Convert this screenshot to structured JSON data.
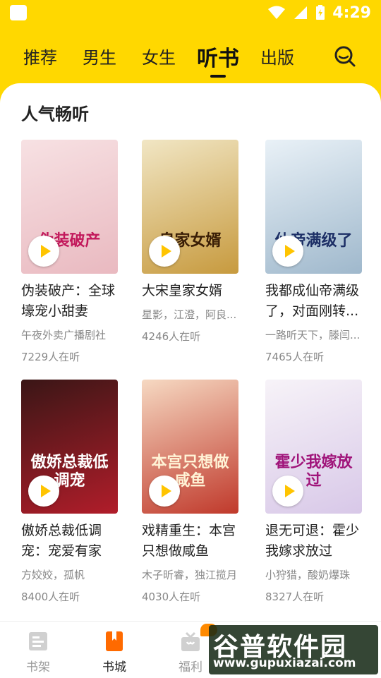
{
  "status_bar": {
    "time": "4:29"
  },
  "top_nav": {
    "tabs": [
      {
        "label": "推荐"
      },
      {
        "label": "男生"
      },
      {
        "label": "女生"
      },
      {
        "label": "听书"
      },
      {
        "label": "出版"
      }
    ],
    "active_tab": "听书",
    "search_icon": "search-icon"
  },
  "section": {
    "title": "人气畅听"
  },
  "books": [
    {
      "title": "伪装破产：全球壕宠小甜妻",
      "author": "午夜外卖广播剧社",
      "listeners": "7229人在听",
      "cover_text": "伪装破产",
      "cover_colors": [
        "#f7e1e3",
        "#e9b9c0"
      ],
      "cover_text_color": "#c2185b"
    },
    {
      "title": "大宋皇家女婿",
      "author": "星影，江澄，阿良...",
      "listeners": "4246人在听",
      "cover_text": "皇家女婿",
      "cover_colors": [
        "#f1e6c4",
        "#c79a3e"
      ],
      "cover_text_color": "#3a1e06"
    },
    {
      "title": "我都成仙帝满级了，对面刚转...",
      "author": "一路听天下，滕闫...",
      "listeners": "7465人在听",
      "cover_text": "仙帝满级了",
      "cover_colors": [
        "#e9f1f7",
        "#9fb8cc"
      ],
      "cover_text_color": "#1d2f66"
    },
    {
      "title": "傲娇总裁低调宠：宠爱有家",
      "author": "方姣姣，孤帆",
      "listeners": "8400人在听",
      "cover_text": "傲娇总裁低调宠",
      "cover_colors": [
        "#3a1616",
        "#b11d2a"
      ],
      "cover_text_color": "#ffffff"
    },
    {
      "title": "戏精重生：本宫只想做咸鱼",
      "author": "木子昕睿，独江揽月",
      "listeners": "4030人在听",
      "cover_text": "本宫只想做咸鱼",
      "cover_colors": [
        "#f6d9c2",
        "#c0392b"
      ],
      "cover_text_color": "#fff3d6"
    },
    {
      "title": "退无可退：霍少我嫁求放过",
      "author": "小狩猎，酸奶爆珠",
      "listeners": "8327人在听",
      "cover_text": "霍少我嫁放过",
      "cover_colors": [
        "#f7f3f8",
        "#d8c8e8"
      ],
      "cover_text_color": "#a0147a"
    }
  ],
  "bottom_nav": [
    {
      "label": "书架",
      "icon": "bookshelf-icon",
      "active": false
    },
    {
      "label": "书城",
      "icon": "bookstore-icon",
      "active": true
    },
    {
      "label": "福利",
      "icon": "gift-icon",
      "active": false
    }
  ],
  "watermark": {
    "main": "谷普软件园",
    "url": "www.gupuxiazai.com"
  },
  "colors": {
    "accent": "#ffd800",
    "active_icon": "#ff6a00",
    "text_primary": "#222222",
    "text_secondary": "#888888"
  }
}
